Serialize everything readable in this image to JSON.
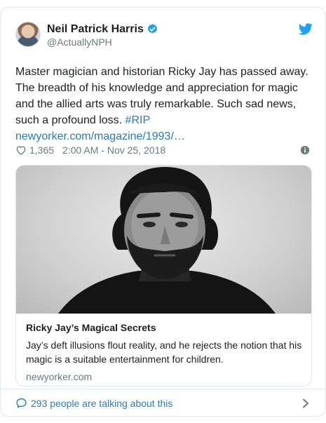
{
  "author": {
    "name": "Neil Patrick Harris",
    "handle": "@ActuallyNPH",
    "verified": true
  },
  "tweet": {
    "text_main": "Master magician and historian Ricky Jay has passed away. The breadth of his knowledge and appreciation for magic and the allied arts was truly remarkable. Such sad news, such a profound loss.",
    "hashtag": "#RIP",
    "link": "newyorker.com/magazine/1993/…"
  },
  "meta": {
    "likes": "1,365",
    "timestamp": "2:00 AM - Nov 25, 2018"
  },
  "card": {
    "title": "Ricky Jay’s Magical Secrets",
    "description": "Jay’s deft illusions flout reality, and he rejects the notion that his magic is a suitable entertainment for children.",
    "domain": "newyorker.com"
  },
  "footer": {
    "conversation": "293 people are talking about this"
  },
  "colors": {
    "link": "#2b7bb9",
    "verified": "#1da1f2",
    "muted": "#697882",
    "border": "#e1e8ed"
  },
  "icons": [
    "verified-badge-icon",
    "twitter-bird-icon",
    "heart-icon",
    "info-icon",
    "reply-bubble-icon",
    "chevron-right-icon"
  ]
}
